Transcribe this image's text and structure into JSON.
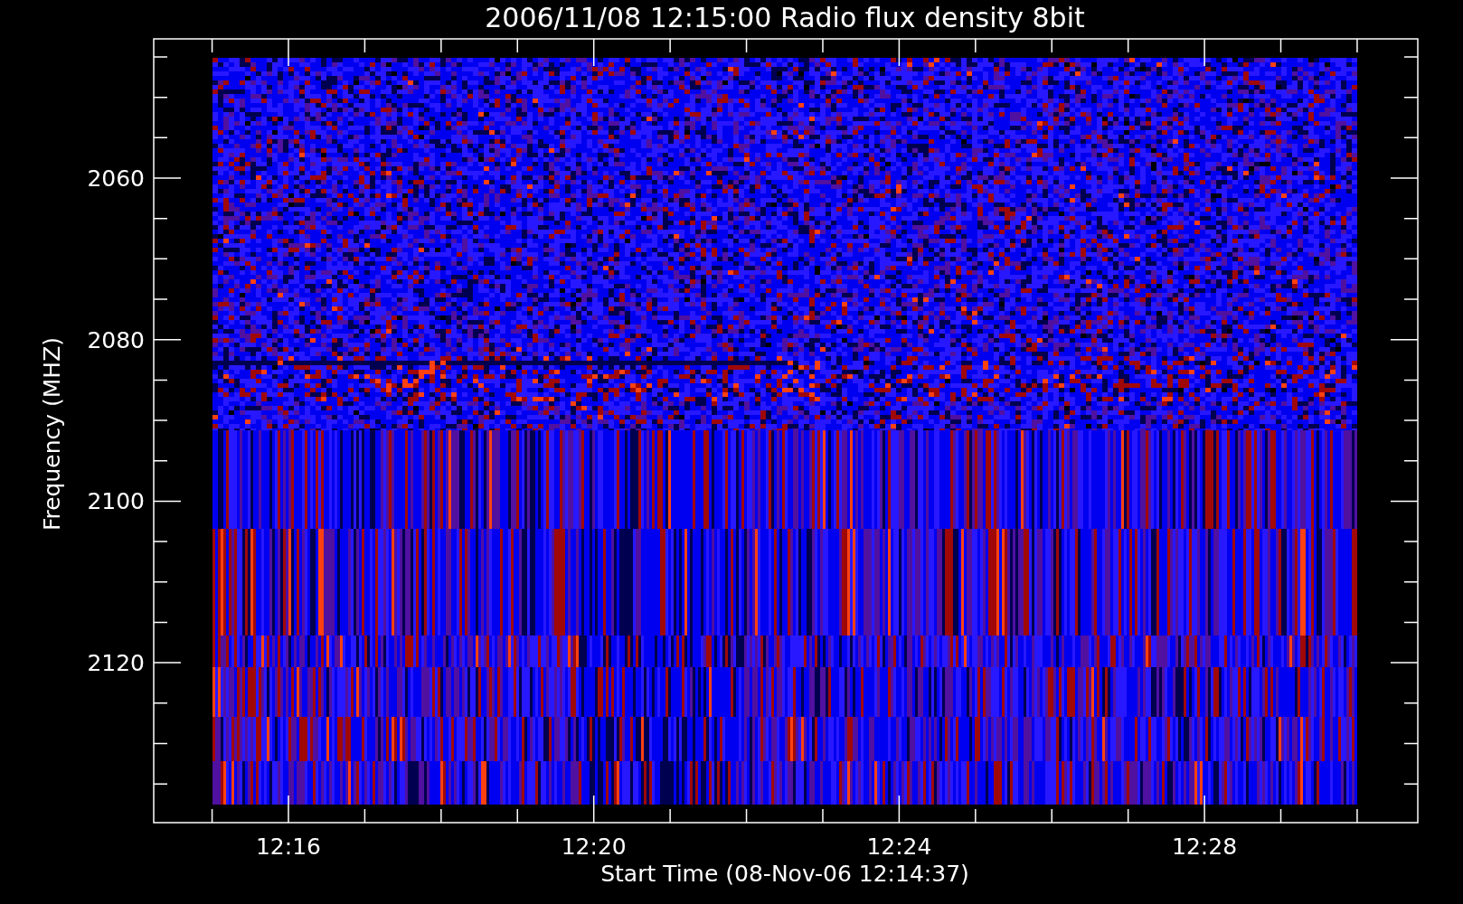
{
  "title": "2006/11/08 12:15:00 Radio flux density 8bit",
  "y_axis": {
    "label": "Frequency (MHZ)",
    "ticks": [
      "2060",
      "2080",
      "2100",
      "2120"
    ]
  },
  "x_axis": {
    "label": "Start Time (08-Nov-06 12:14:37)",
    "ticks": [
      "12:16",
      "12:20",
      "12:24",
      "12:28"
    ]
  }
}
